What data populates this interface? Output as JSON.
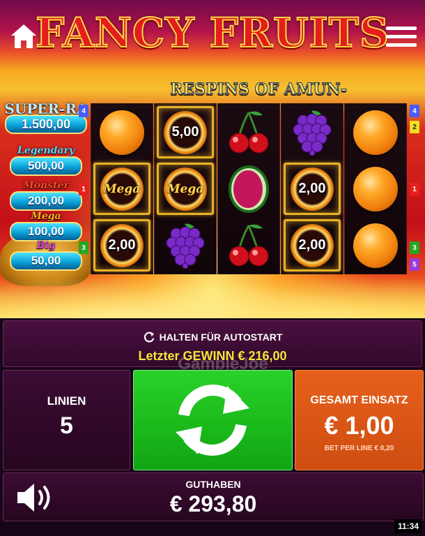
{
  "header": {
    "title": "FANCY FRUITS",
    "subtitle": "RESPINS OF AMUN-RE",
    "home_icon": "home-icon",
    "menu_icon": "hamburger-menu-icon"
  },
  "jackpots": [
    {
      "name": "SUPER-RA",
      "value": "1.500,00",
      "color": "#bfe8ff"
    },
    {
      "name": "Legendary",
      "value": "500,00",
      "color": "#5fd6ff"
    },
    {
      "name": "Monster",
      "value": "200,00",
      "color": "#ff4a2a"
    },
    {
      "name": "Mega",
      "value": "100,00",
      "color": "#ffb020"
    },
    {
      "name": "Big",
      "value": "50,00",
      "color": "#e040e0"
    }
  ],
  "reels": [
    [
      {
        "type": "orange"
      },
      {
        "type": "mega-coin",
        "label": "Mega"
      },
      {
        "type": "coin",
        "label": "2,00"
      }
    ],
    [
      {
        "type": "coin",
        "label": "5,00"
      },
      {
        "type": "mega-coin",
        "label": "Mega"
      },
      {
        "type": "grapes"
      }
    ],
    [
      {
        "type": "cherry"
      },
      {
        "type": "melon"
      },
      {
        "type": "cherry"
      }
    ],
    [
      {
        "type": "grapes"
      },
      {
        "type": "coin",
        "label": "2,00"
      },
      {
        "type": "coin",
        "label": "2,00"
      }
    ],
    [
      {
        "type": "orange"
      },
      {
        "type": "orange"
      },
      {
        "type": "orange"
      }
    ]
  ],
  "paylines": {
    "left": [
      {
        "label": "4",
        "row_pos": "top",
        "color": "#4a5cff"
      },
      {
        "label": "1",
        "row_pos": "middle",
        "color": "#e8201e"
      },
      {
        "label": "3",
        "row_pos": "bottom",
        "color": "#22a822"
      }
    ],
    "right": [
      {
        "label": "4",
        "row_pos": "top-a",
        "color": "#4a5cff"
      },
      {
        "label": "2",
        "row_pos": "top-b",
        "color": "#f0e020"
      },
      {
        "label": "1",
        "row_pos": "middle",
        "color": "#e8201e"
      },
      {
        "label": "3",
        "row_pos": "bottom-a",
        "color": "#22a822"
      },
      {
        "label": "5",
        "row_pos": "bottom-b",
        "color": "#9a3ad8"
      }
    ]
  },
  "info": {
    "autostart_label": "HALTEN FÜR AUTOSTART",
    "last_win_label": "Letzter GEWINN € 216,00",
    "watermark": "GambleJoe"
  },
  "controls": {
    "lines_label": "LINIEN",
    "lines_value": "5",
    "spin_icon": "refresh-spin-icon",
    "bet_label": "GESAMT EINSATZ",
    "bet_value": "€ 1,00",
    "bet_per_line": "BET PER LINE € 0,20",
    "balance_label": "GUTHABEN",
    "balance_value": "€ 293,80",
    "sound_icon": "speaker-icon"
  },
  "status": {
    "time": "11:34"
  },
  "colors": {
    "spin_green": "#1fc11f",
    "bet_orange": "#dd5816",
    "win_yellow": "#f3e636",
    "panel_purple": "#3c0c34"
  }
}
